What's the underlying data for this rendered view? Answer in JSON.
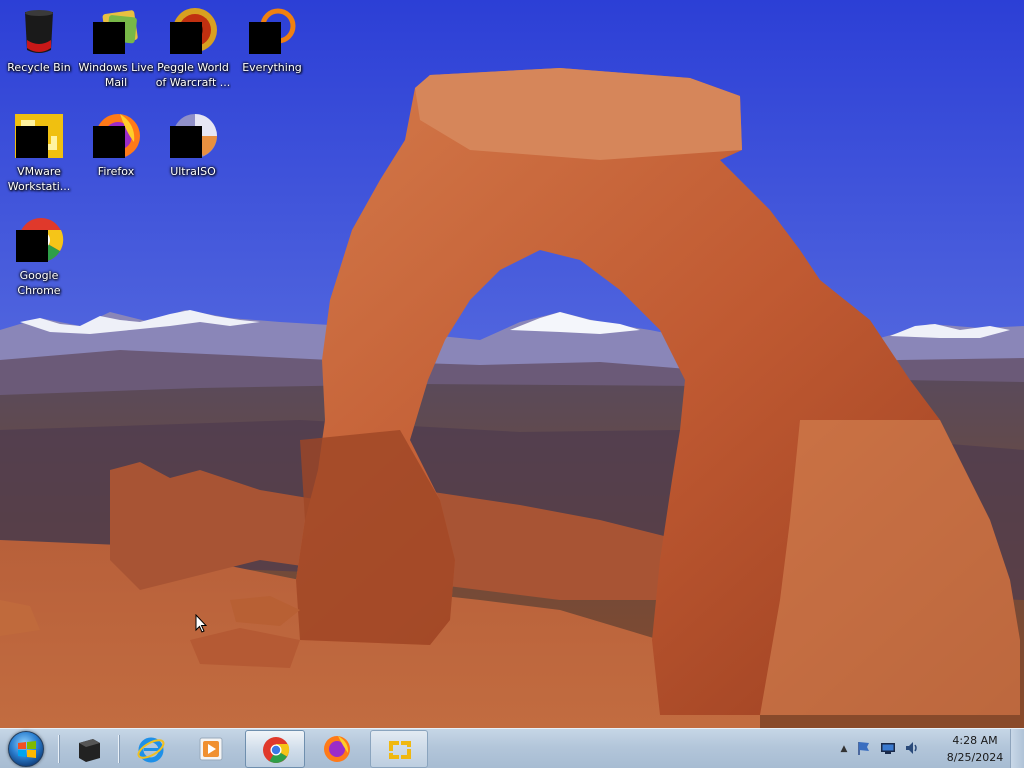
{
  "desktop": {
    "icons": [
      {
        "label": "Recycle Bin",
        "icon": "recycle-bin-icon"
      },
      {
        "label": "Windows Live Mail",
        "icon": "windows-live-mail-icon"
      },
      {
        "label": "Peggle World of Warcraft ...",
        "icon": "peggle-icon"
      },
      {
        "label": "Everything",
        "icon": "everything-search-icon"
      },
      {
        "label": "VMware Workstati...",
        "icon": "vmware-icon"
      },
      {
        "label": "Firefox",
        "icon": "firefox-icon"
      },
      {
        "label": "UltraISO",
        "icon": "ultraiso-disc-icon"
      },
      {
        "label": "Google Chrome",
        "icon": "chrome-icon"
      }
    ]
  },
  "taskbar": {
    "start": {
      "icon": "windows-logo-icon"
    },
    "items": [
      {
        "name": "terminal",
        "icon": "terminal-icon",
        "state": "pinned"
      },
      {
        "name": "internet-explorer",
        "icon": "internet-explorer-icon",
        "state": "pinned"
      },
      {
        "name": "media-player",
        "icon": "media-player-icon",
        "state": "pinned"
      },
      {
        "name": "chrome",
        "icon": "chrome-icon",
        "state": "active"
      },
      {
        "name": "firefox",
        "icon": "firefox-icon",
        "state": "pinned"
      },
      {
        "name": "vmware",
        "icon": "vmware-icon",
        "state": "running"
      }
    ]
  },
  "tray": {
    "icons": [
      "show-hidden-icons-chevron",
      "action-center-flag-icon",
      "network-monitor-icon",
      "volume-icon"
    ],
    "time": "4:28 AM",
    "date": "8/25/2024"
  },
  "colors": {
    "sky_top": "#2c3fd6",
    "sky_bottom": "#7f94e6",
    "rock": "#c8623a",
    "taskbar": "#b8cadc"
  }
}
